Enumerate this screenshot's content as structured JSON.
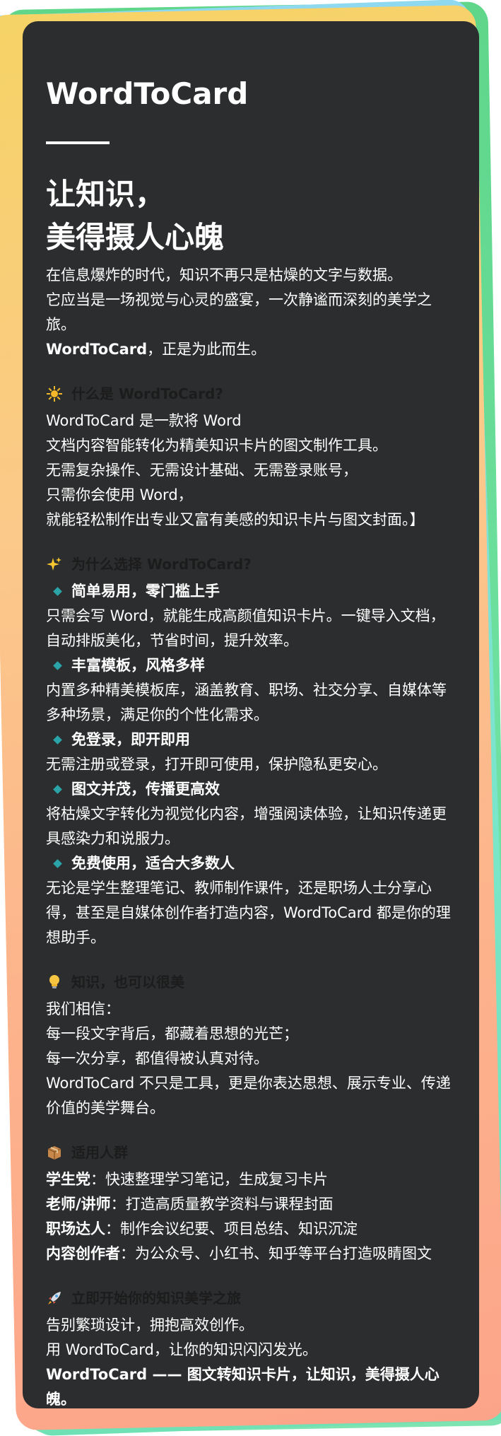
{
  "card": {
    "brand": "WordToCard",
    "headline": [
      "让知识，",
      "美得摄人心魄"
    ],
    "intro": [
      "在信息爆炸的时代，知识不再只是枯燥的文字与数据。",
      "它应当是一场视觉与心灵的盛宴，一次静谧而深刻的美学之旅。"
    ],
    "intro_bold": "WordToCard",
    "intro_tail": "，正是为此而生。"
  },
  "sections": {
    "what": {
      "icon": "sun-icon",
      "title": "什么是 WordToCard?",
      "lines": [
        "WordToCard 是一款将 Word",
        "文档内容智能转化为精美知识卡片的图文制作工具。",
        "无需复杂操作、无需设计基础、无需登录账号，",
        "只需你会使用 Word，",
        "就能轻松制作出专业又富有美感的知识卡片与图文封面。】"
      ]
    },
    "why": {
      "icon": "sparkles-icon",
      "title": "为什么选择 WordToCard?",
      "features": [
        {
          "title": "简单易用，零门槛上手",
          "desc": "只需会写 Word，就能生成高颜值知识卡片。一键导入文档，自动排版美化，节省时间，提升效率。"
        },
        {
          "title": "丰富模板，风格多样",
          "desc": "内置多种精美模板库，涵盖教育、职场、社交分享、自媒体等多种场景，满足你的个性化需求。"
        },
        {
          "title": "免登录，即开即用",
          "desc": "无需注册或登录，打开即可使用，保护隐私更安心。"
        },
        {
          "title": "图文并茂，传播更高效",
          "desc": "将枯燥文字转化为视觉化内容，增强阅读体验，让知识传递更具感染力和说服力。"
        },
        {
          "title": "免费使用，适合大多数人",
          "desc": "无论是学生整理笔记、教师制作课件，还是职场人士分享心得，甚至是自媒体创作者打造内容，WordToCard 都是你的理想助手。"
        }
      ]
    },
    "beauty": {
      "icon": "lightbulb-icon",
      "title": "知识，也可以很美",
      "lines": [
        "我们相信：",
        "每一段文字背后，都藏着思想的光芒；",
        "每一次分享，都值得被认真对待。",
        "WordToCard 不只是工具，更是你表达思想、展示专业、传递价值的美学舞台。"
      ]
    },
    "audience": {
      "icon": "package-icon",
      "title": "适用人群",
      "items": [
        {
          "label": "学生党",
          "text": "：快速整理学习笔记，生成复习卡片"
        },
        {
          "label": "老师/讲师",
          "text": "：打造高质量教学资料与课程封面"
        },
        {
          "label": "职场达人",
          "text": "：制作会议纪要、项目总结、知识沉淀"
        },
        {
          "label": "内容创作者",
          "text": "：为公众号、小红书、知乎等平台打造吸睛图文"
        }
      ]
    },
    "start": {
      "icon": "rocket-icon",
      "title": "立即开始你的知识美学之旅",
      "lines": [
        "告别繁琐设计，拥抱高效创作。",
        "用 WordToCard，让你的知识闪闪发光。"
      ],
      "closing": "WordToCard —— 图文转知识卡片，让知识，美得摄人心魄。"
    }
  }
}
